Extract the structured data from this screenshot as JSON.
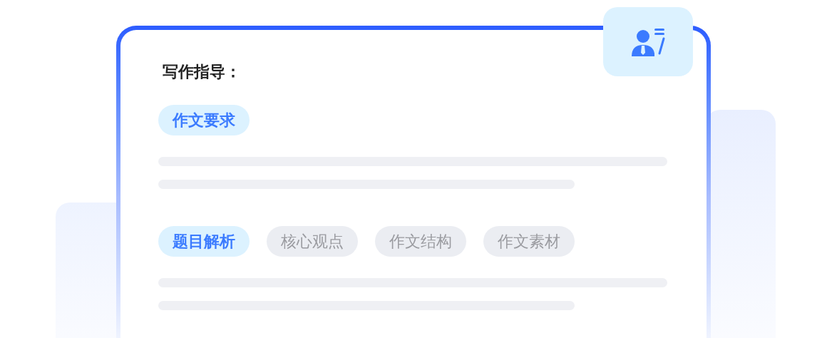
{
  "title": "写作指导：",
  "sections": [
    {
      "tags": [
        {
          "label": "作文要求",
          "selected": true
        }
      ]
    },
    {
      "tags": [
        {
          "label": "题目解析",
          "selected": true
        },
        {
          "label": "核心观点",
          "selected": false
        },
        {
          "label": "作文结构",
          "selected": false
        },
        {
          "label": "作文素材",
          "selected": false
        }
      ]
    }
  ]
}
